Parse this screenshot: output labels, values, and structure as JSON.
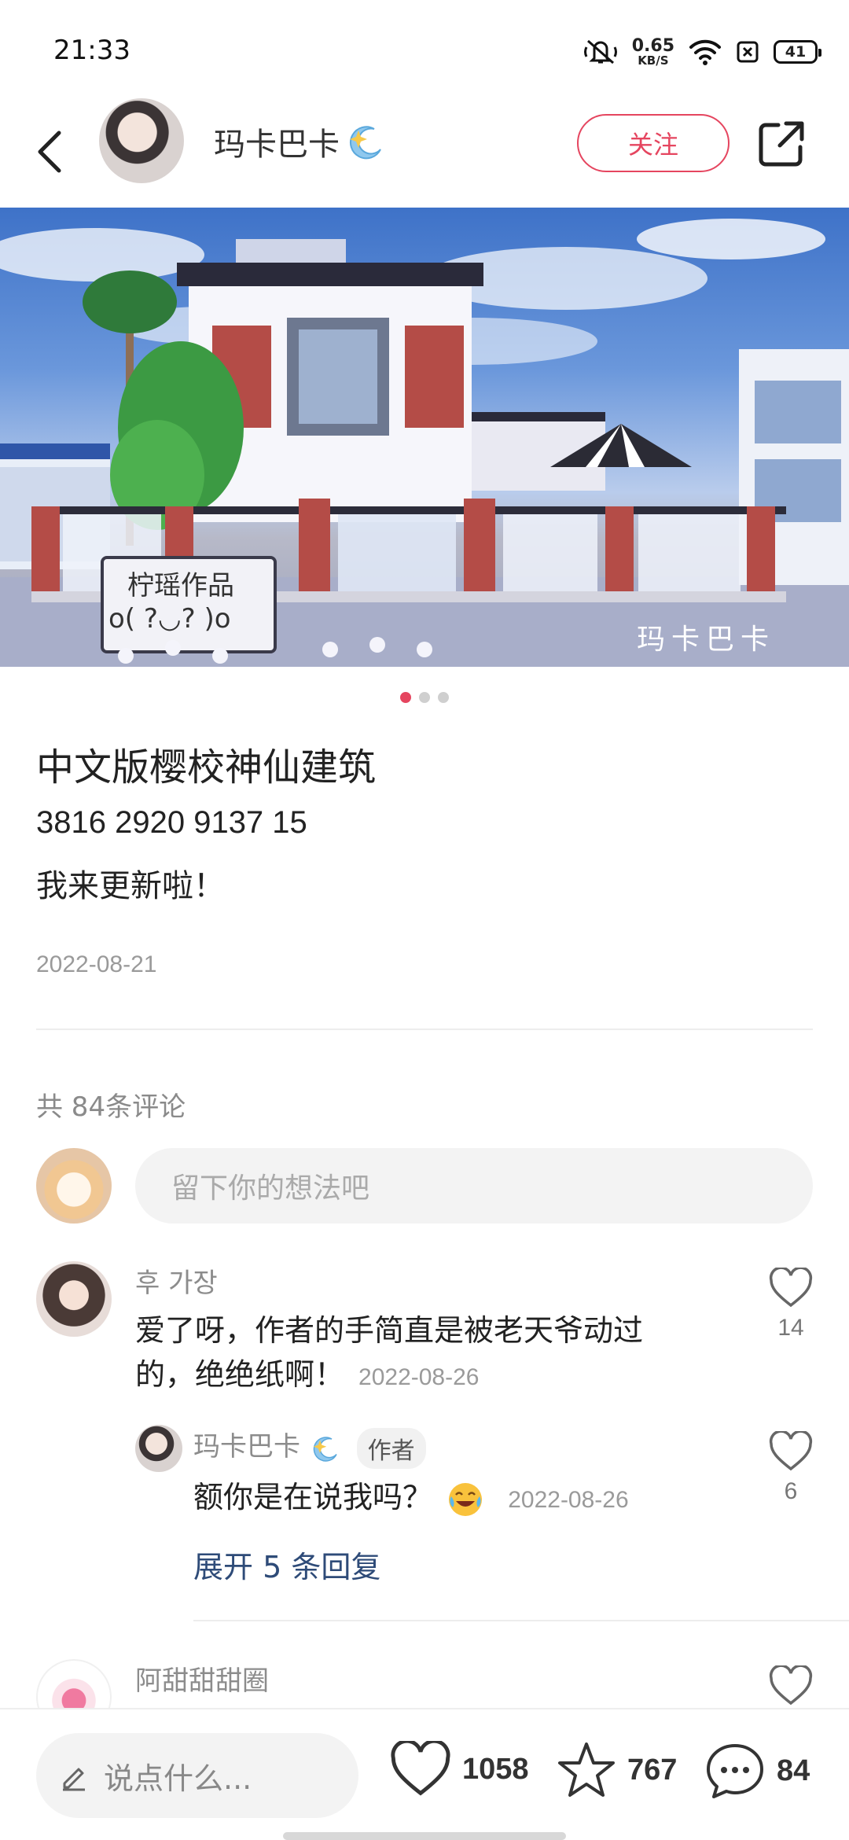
{
  "status_bar": {
    "time": "21:33",
    "net_speed_value": "0.65",
    "net_speed_unit": "KB/S",
    "battery": "41",
    "icons": [
      "mute-icon",
      "wifi-icon",
      "sim-icon",
      "battery-icon"
    ]
  },
  "header": {
    "author_name": "玛卡巴卡",
    "follow_label": "关注",
    "icons": [
      "back-icon",
      "share-icon"
    ]
  },
  "banner": {
    "watermark": "玛卡巴卡",
    "sign_line1": "柠瑶作品",
    "sign_line2": "o( ?◡? )o",
    "page_count": 3,
    "active_page": 1
  },
  "post": {
    "title": "中文版樱校神仙建筑",
    "body_line1": "3816 2920 9137 15",
    "body_line2": "我来更新啦！",
    "date": "2022-08-21"
  },
  "comments_section": {
    "count_label": "共 84条评论",
    "input_placeholder": "留下你的想法吧",
    "comments": [
      {
        "name": "후 가장",
        "text_line1": "爱了呀，作者的手简直是被老天爷动过",
        "text_line2": "的，绝绝纸啊！",
        "date": "2022-08-26",
        "likes": "14"
      },
      {
        "name": "玛卡巴卡",
        "tag": "作者",
        "text": "额你是在说我吗？",
        "date": "2022-08-26",
        "likes": "6"
      },
      {
        "name": "阿甜甜甜圈"
      }
    ],
    "expand_label": "展开 5 条回复"
  },
  "bottom_bar": {
    "say_placeholder": "说点什么...",
    "likes": "1058",
    "stars": "767",
    "comments": "84"
  },
  "colors": {
    "accent": "#e5455f",
    "link": "#2e4b78"
  }
}
